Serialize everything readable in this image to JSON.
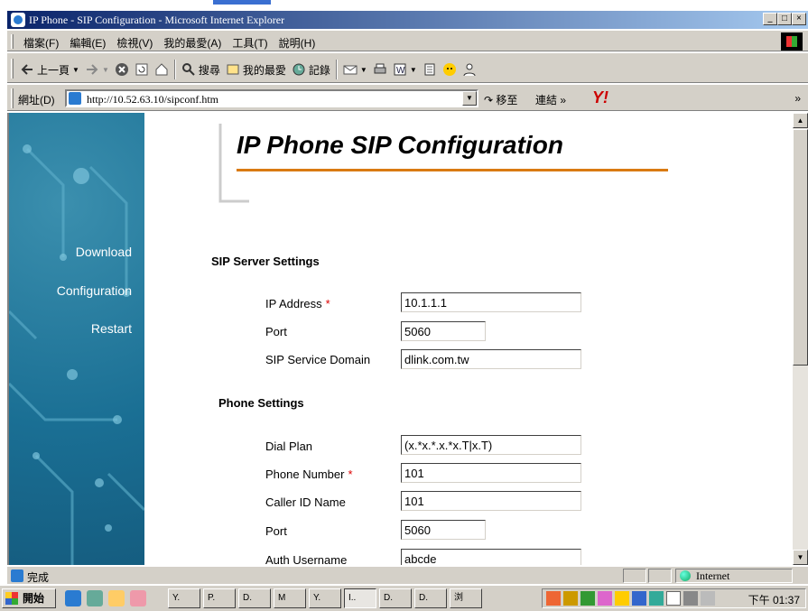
{
  "window": {
    "title": "IP Phone - SIP Configuration - Microsoft Internet Explorer",
    "minimize_glyph": "_",
    "maximize_glyph": "□",
    "close_glyph": "×"
  },
  "menu": {
    "items": [
      "檔案(F)",
      "編輯(E)",
      "檢視(V)",
      "我的最愛(A)",
      "工具(T)",
      "說明(H)"
    ]
  },
  "toolbar": {
    "back_label": "上一頁",
    "search_label": "搜尋",
    "favorites_label": "我的最愛",
    "history_label": "記錄"
  },
  "address": {
    "label": "網址(D)",
    "url": "http://10.52.63.10/sipconf.htm",
    "go_label": "移至",
    "links_label": "連結 »",
    "more_glyph": "»",
    "yahoo_text": "Y!"
  },
  "sidebar": {
    "links": [
      "Download",
      "Configuration",
      "Restart"
    ]
  },
  "page": {
    "title": "IP Phone SIP Configuration",
    "sip_server_heading": "SIP Server Settings",
    "phone_heading": "Phone Settings",
    "required_marker": "*",
    "sip_server_fields": {
      "ip_label": "IP Address",
      "ip_value": "10.1.1.1",
      "port_label": "Port",
      "port_value": "5060",
      "domain_label": "SIP Service Domain",
      "domain_value": "dlink.com.tw"
    },
    "phone_fields": {
      "dial_plan_label": "Dial Plan",
      "dial_plan_value": "(x.*x.*.x.*x.T|x.T)",
      "phone_number_label": "Phone Number",
      "phone_number_value": "101",
      "caller_id_label": "Caller ID Name",
      "caller_id_value": "101",
      "port_label": "Port",
      "port_value": "5060",
      "auth_username_label": "Auth Username",
      "auth_username_value": "abcde"
    }
  },
  "status": {
    "text": "完成",
    "zone": "Internet"
  },
  "taskbar": {
    "start_label": "開始",
    "tasks": [
      "Y.",
      "P.",
      "D.",
      "M",
      "Y.",
      "I..",
      "D.",
      "D.",
      "浏"
    ],
    "clock": "下午 01:37"
  },
  "colors": {
    "title_rule": "#d97a12",
    "sidebar": "#1a6f94",
    "required": "#dd0000"
  }
}
